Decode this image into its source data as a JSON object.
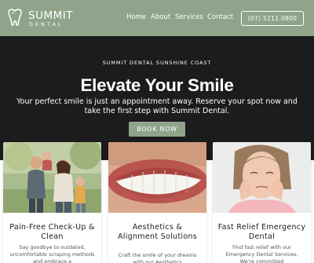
{
  "colors": {
    "header_bg": "#8fa48b",
    "hero_bg": "#1c1b1d",
    "accent": "#8fa48b",
    "text_light": "#ffffff"
  },
  "header": {
    "logo_name": "SUMMIT",
    "logo_sub": "DENTAL",
    "logo_icon": "tooth-icon",
    "nav": [
      "Home",
      "About",
      "Services",
      "Contact"
    ],
    "phone": "(07) 5211 0800"
  },
  "hero": {
    "kicker": "SUMMIT DENTAL SUNSHINE COAST",
    "title": "Elevate Your Smile",
    "text": "Your perfect smile is just an appointment away. Reserve your spot now and take the first step with Summit Dental.",
    "button": "BOOK NOW"
  },
  "cards": [
    {
      "image": "family-photo",
      "title": "Pain-Free Check-Up & Clean",
      "desc": "Say goodbye to outdated, uncomfortable scraping methods and embrace a"
    },
    {
      "image": "smile-closeup-photo",
      "title": "Aesthetics & Alignment Solutions",
      "desc": "Craft the smile of your dreams with our Aesthetics"
    },
    {
      "image": "toothache-woman-photo",
      "title": "Fast Relief Emergency Dental",
      "desc": "Find fast relief with our Emergency Dental Services. We're committed"
    }
  ]
}
